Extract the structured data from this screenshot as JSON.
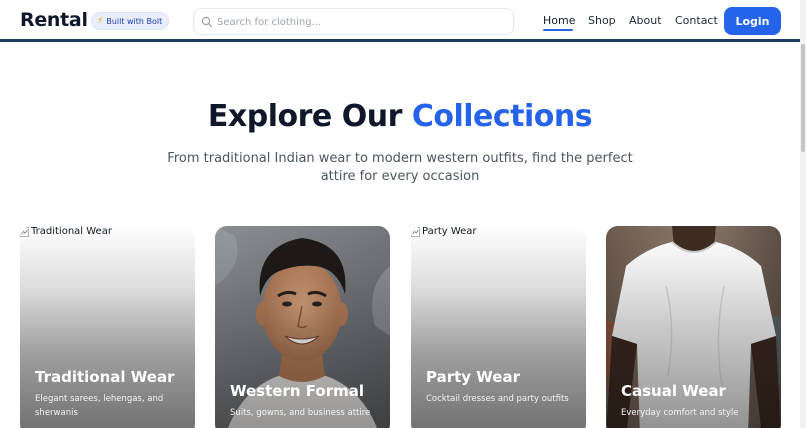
{
  "brand": {
    "name": "Rental",
    "badge": "Built with Bolt"
  },
  "search": {
    "placeholder": "Search for clothing..."
  },
  "nav": {
    "items": [
      {
        "label": "Home",
        "active": true
      },
      {
        "label": "Shop"
      },
      {
        "label": "About"
      },
      {
        "label": "Contact"
      }
    ],
    "login_label": "Login"
  },
  "colors": {
    "accent": "#2563eb",
    "title": "#0f172a",
    "nav_border": "#1e3a5f"
  },
  "section": {
    "title_main": "Explore Our",
    "title_accent": "Collections",
    "subtitle": "From traditional Indian wear to modern western outfits, find the perfect attire for every occasion"
  },
  "collections": [
    {
      "title": "Traditional Wear",
      "description": "Elegant sarees, lehengas, and sherwanis",
      "image_alt": "Traditional Wear",
      "image_state": "broken"
    },
    {
      "title": "Western Formal",
      "description": "Suits, gowns, and business attire",
      "image_state": "portrait photo"
    },
    {
      "title": "Party Wear",
      "description": "Cocktail dresses and party outfits",
      "image_alt": "Party Wear",
      "image_state": "broken"
    },
    {
      "title": "Casual Wear",
      "description": "Everyday comfort and style",
      "image_state": "white t-shirt photo"
    }
  ]
}
